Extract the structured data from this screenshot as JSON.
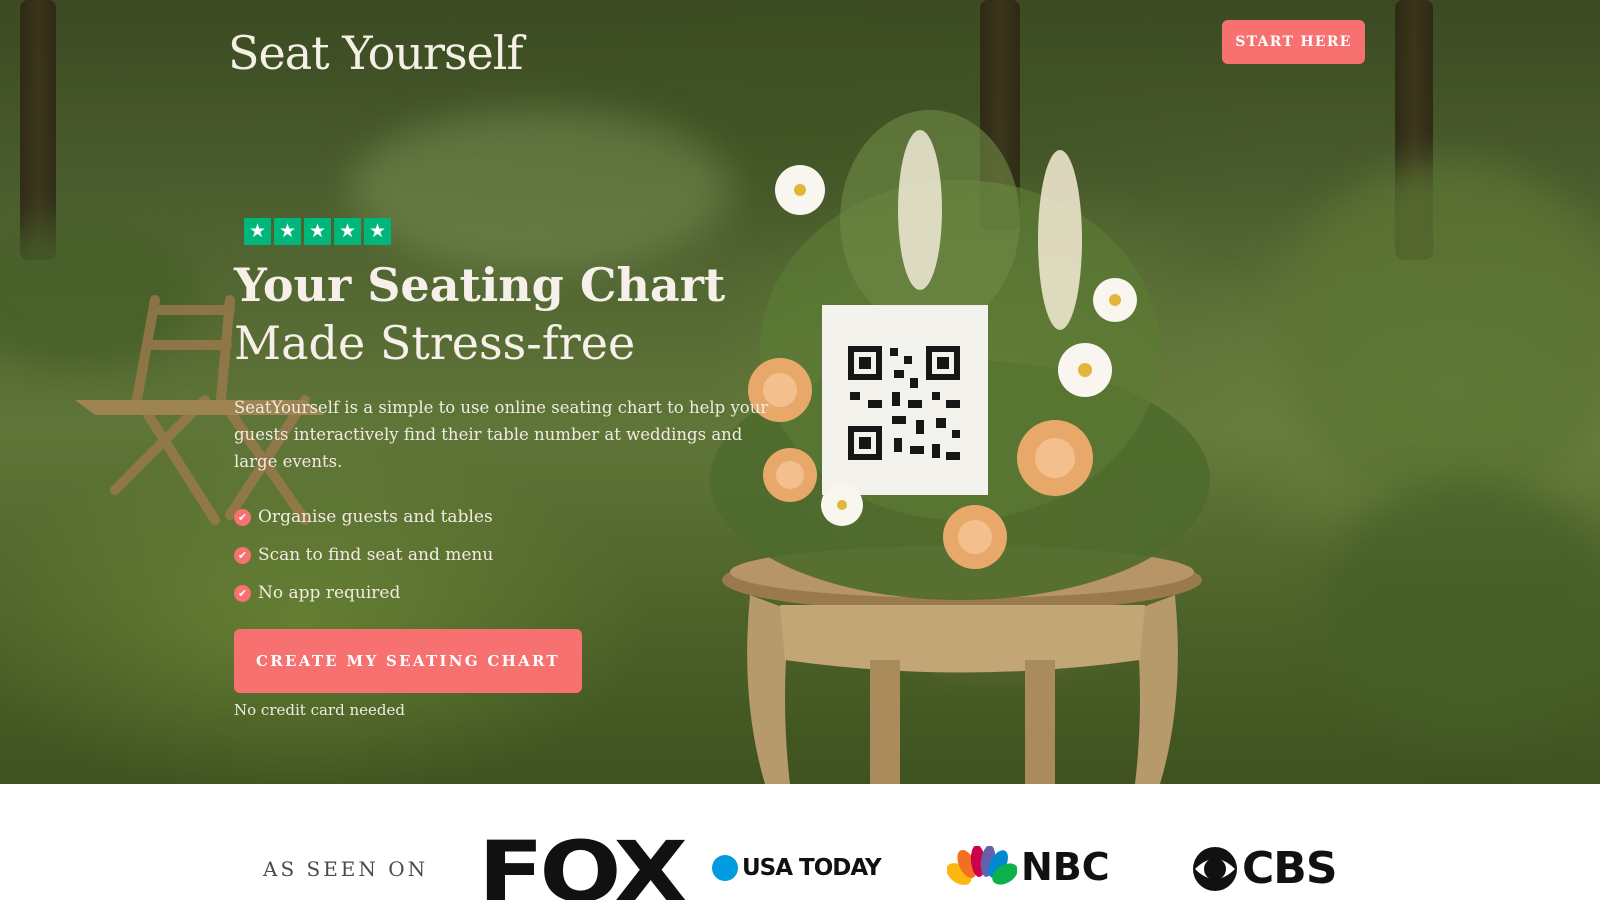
{
  "header": {
    "brand": "Seat Yourself",
    "start_button": "START HERE"
  },
  "hero": {
    "rating_stars": 5,
    "headline_line1": "Your Seating Chart",
    "headline_line2": "Made Stress-free",
    "description": "SeatYourself is a simple to use online seating chart to help your guests interactively find their table number at weddings and large events.",
    "features": [
      "Organise guests and tables",
      "Scan to find seat and menu",
      "No app required"
    ],
    "cta_button": "CREATE MY SEATING CHART",
    "cta_note": "No credit card needed"
  },
  "press": {
    "label": "AS SEEN ON",
    "logos": [
      "FOX",
      "USA TODAY",
      "NBC",
      "CBS"
    ]
  },
  "colors": {
    "accent": "#f87171",
    "star_green": "#00b67a",
    "usa_today_blue": "#009bdf"
  },
  "icons": {
    "star": "star-icon",
    "check": "check-circle-icon"
  }
}
